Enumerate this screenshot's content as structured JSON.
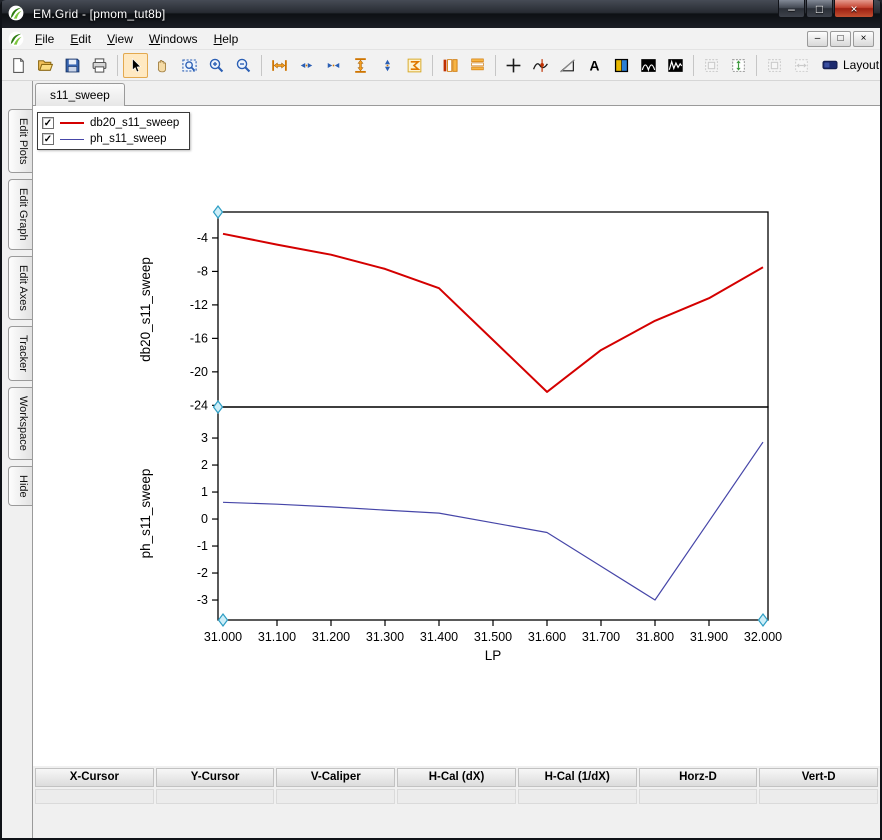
{
  "window": {
    "title": "EM.Grid - [pmom_tut8b]",
    "buttons": {
      "minimize": "–",
      "maximize": "□",
      "close": "×"
    }
  },
  "menu": {
    "items": [
      "File",
      "Edit",
      "View",
      "Windows",
      "Help"
    ],
    "child_buttons": {
      "minimize": "–",
      "restore": "□",
      "close": "×"
    }
  },
  "toolbar": {
    "layout_label": "Layout",
    "items": [
      {
        "name": "new-document",
        "icon": "new-document"
      },
      {
        "name": "open-file",
        "icon": "open-folder"
      },
      {
        "name": "save",
        "icon": "save"
      },
      {
        "name": "print",
        "icon": "print"
      },
      {
        "name": "select-cursor",
        "icon": "select-cursor",
        "sep": true,
        "selected": true
      },
      {
        "name": "pan",
        "icon": "pan-hand"
      },
      {
        "name": "zoom-region",
        "icon": "zoom-region"
      },
      {
        "name": "zoom-in",
        "icon": "zoom-in"
      },
      {
        "name": "zoom-out",
        "icon": "zoom-out"
      },
      {
        "name": "expand-x-axis",
        "icon": "expand-x",
        "sep": true
      },
      {
        "name": "shift-x-out",
        "icon": "arrows-x-out"
      },
      {
        "name": "shift-x-in",
        "icon": "arrows-x-in"
      },
      {
        "name": "expand-y-axis",
        "icon": "expand-y"
      },
      {
        "name": "shift-y",
        "icon": "arrows-y"
      },
      {
        "name": "autoscale",
        "icon": "autoscale"
      },
      {
        "name": "column-layout",
        "icon": "columns",
        "sep": true
      },
      {
        "name": "row-layout",
        "icon": "rows"
      },
      {
        "name": "crosshair-cursor",
        "icon": "crosshair",
        "sep": true
      },
      {
        "name": "curve-tracker",
        "icon": "tracker"
      },
      {
        "name": "slope-marker",
        "icon": "slope"
      },
      {
        "name": "text-annotation",
        "icon": "text-a"
      },
      {
        "name": "color-map",
        "icon": "color-map"
      },
      {
        "name": "waveform-view-1",
        "icon": "waveform-1"
      },
      {
        "name": "waveform-view-2",
        "icon": "waveform-2"
      },
      {
        "name": "fit-window",
        "icon": "fit-box",
        "sep": true,
        "disabled": true
      },
      {
        "name": "fit-vertical",
        "icon": "fit-v"
      },
      {
        "name": "fit-window-horizontal",
        "icon": "fit-box",
        "sep": true,
        "disabled": true
      },
      {
        "name": "fit-horizontal",
        "icon": "fit-h",
        "disabled": true
      }
    ]
  },
  "sidebar": {
    "tabs": [
      "Edit Plots",
      "Edit Graph",
      "Edit Axes",
      "Tracker",
      "Workspace",
      "Hide"
    ]
  },
  "document_tab": "s11_sweep",
  "legend": {
    "check_glyph": "✓",
    "items": [
      {
        "label": "db20_s11_sweep",
        "color": "#d40000",
        "width": 2,
        "checked": true
      },
      {
        "label": "ph_s11_sweep",
        "color": "#4646a8",
        "width": 1,
        "checked": true
      }
    ]
  },
  "chart_data": [
    {
      "type": "line",
      "ylabel": "db20_s11_sweep",
      "xlim": [
        31.0,
        32.0
      ],
      "ylim": [
        -24.2,
        -0.9
      ],
      "yticks": [
        -4,
        -8,
        -12,
        -16,
        -20,
        -24
      ],
      "grid": false,
      "legend_position": "top-left-overlay",
      "series": [
        {
          "name": "db20_s11_sweep",
          "color": "#d40000",
          "width": 2,
          "x": [
            31.0,
            31.1,
            31.2,
            31.3,
            31.4,
            31.5,
            31.6,
            31.7,
            31.8,
            31.9,
            32.0
          ],
          "y": [
            -3.5,
            -4.8,
            -6.0,
            -7.7,
            -10.0,
            -16.2,
            -22.4,
            -17.4,
            -13.9,
            -11.2,
            -7.5
          ]
        }
      ]
    },
    {
      "type": "line",
      "ylabel": "ph_s11_sweep",
      "xlabel": "LP",
      "xlim": [
        31.0,
        32.0
      ],
      "ylim": [
        -3.74,
        4.15
      ],
      "yticks": [
        3,
        2,
        1,
        0,
        -1,
        -2,
        -3
      ],
      "xticks": [
        31.0,
        31.1,
        31.2,
        31.3,
        31.4,
        31.5,
        31.6,
        31.7,
        31.8,
        31.9,
        32.0
      ],
      "xtick_labels": [
        "31.000",
        "31.100",
        "31.200",
        "31.300",
        "31.400",
        "31.500",
        "31.600",
        "31.700",
        "31.800",
        "31.900",
        "32.000"
      ],
      "grid": false,
      "series": [
        {
          "name": "ph_s11_sweep",
          "color": "#4646a8",
          "width": 1.2,
          "x": [
            31.0,
            31.1,
            31.2,
            31.3,
            31.4,
            31.5,
            31.6,
            31.7,
            31.8,
            31.9,
            32.0
          ],
          "y": [
            0.62,
            0.55,
            0.45,
            0.33,
            0.22,
            -0.14,
            -0.5,
            -1.75,
            -3.0,
            -0.08,
            2.85
          ]
        }
      ]
    }
  ],
  "cursor_table": {
    "columns": [
      "X-Cursor",
      "Y-Cursor",
      "V-Caliper",
      "H-Cal (dX)",
      "H-Cal (1/dX)",
      "Horz-D",
      "Vert-D"
    ],
    "rows": [
      [
        "",
        "",
        "",
        "",
        "",
        "",
        ""
      ]
    ]
  },
  "colors": {
    "titlebar": "#15181d",
    "series_red": "#d40000",
    "series_blue": "#4646a8",
    "cursor_diamond_fill": "#cdeef8",
    "cursor_diamond_stroke": "#2e9ec4"
  }
}
